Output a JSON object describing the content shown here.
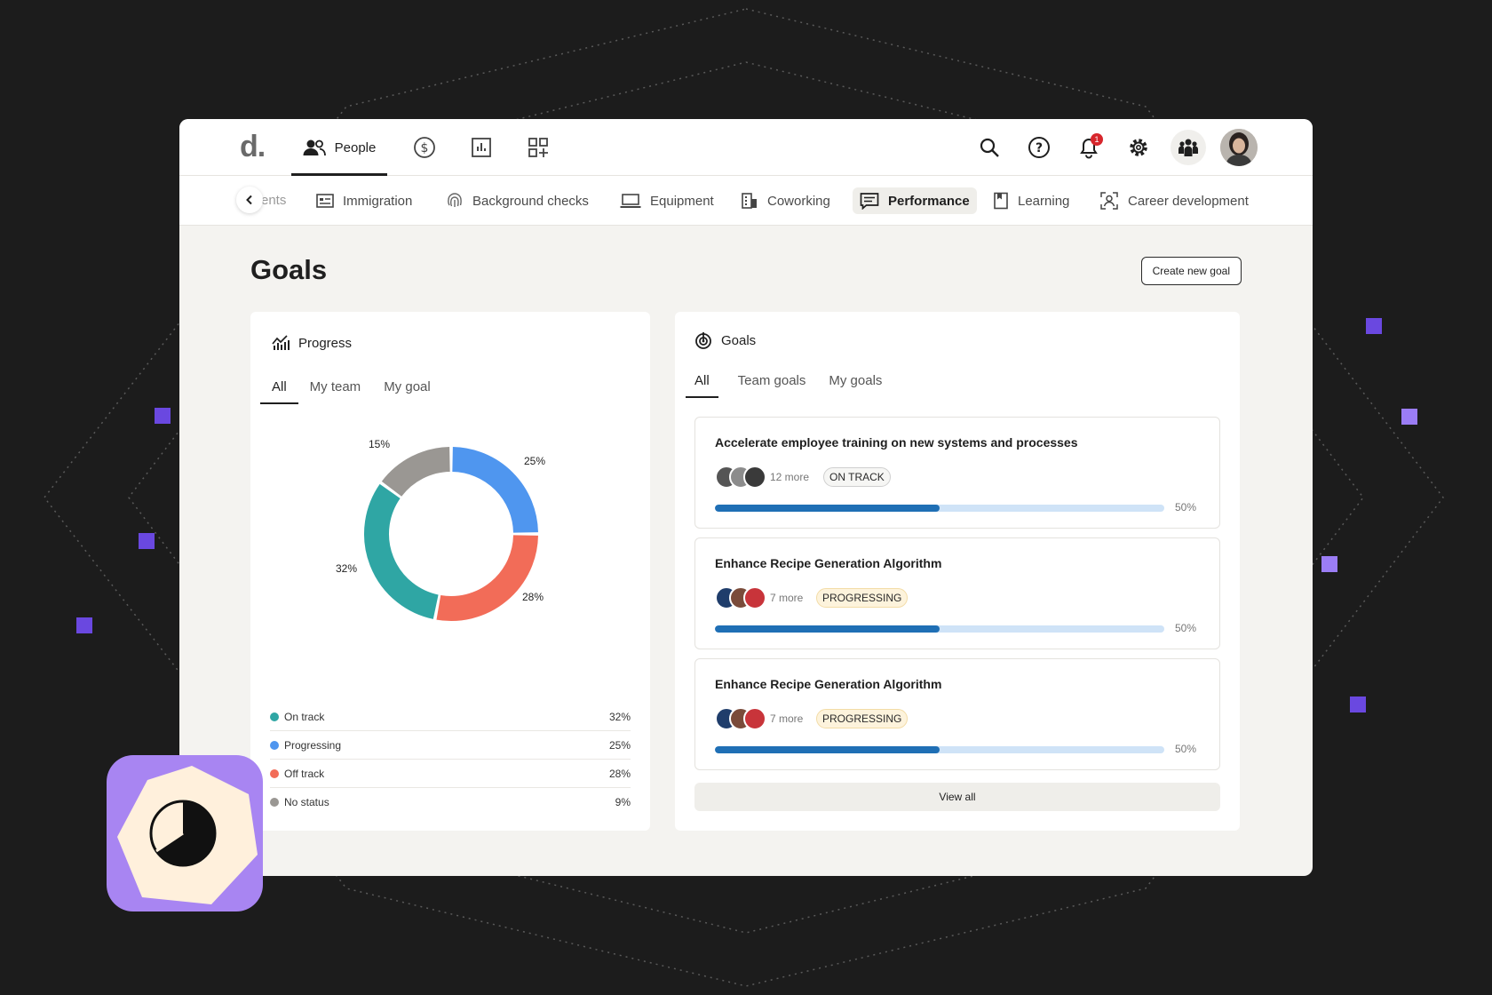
{
  "colors": {
    "accent": "#1f6fb5",
    "on_track": "#2fa6a4",
    "progressing": "#4f96ef",
    "off_track": "#f26c58",
    "no_status": "#9a9793",
    "badge_bg": "#a885f2",
    "deco_square": "#7d5cf0"
  },
  "topnav": {
    "logo": "d.",
    "people_label": "People",
    "notification_count": "1"
  },
  "subnav": {
    "faded_item": "ents",
    "items": [
      {
        "label": "Immigration",
        "icon": "id-card-icon"
      },
      {
        "label": "Background checks",
        "icon": "fingerprint-icon"
      },
      {
        "label": "Equipment",
        "icon": "laptop-icon"
      },
      {
        "label": "Coworking",
        "icon": "building-icon"
      },
      {
        "label": "Performance",
        "icon": "message-square-icon"
      },
      {
        "label": "Learning",
        "icon": "bookmark-icon"
      },
      {
        "label": "Career development",
        "icon": "user-focus-icon"
      }
    ]
  },
  "page": {
    "title": "Goals",
    "create_button": "Create new goal"
  },
  "progress_card": {
    "title": "Progress",
    "tabs": [
      "All",
      "My team",
      "My goal"
    ],
    "legend": [
      {
        "label": "On track",
        "value": "32%"
      },
      {
        "label": "Progressing",
        "value": "25%"
      },
      {
        "label": "Off track",
        "value": "28%"
      },
      {
        "label": "No status",
        "value": "9%"
      }
    ]
  },
  "chart_data": {
    "type": "pie",
    "categories": [
      "Progressing",
      "Off track",
      "On track",
      "No status"
    ],
    "values": [
      25,
      28,
      32,
      15
    ],
    "labels": [
      "25%",
      "28%",
      "32%",
      "15%"
    ]
  },
  "goals_card": {
    "title": "Goals",
    "tabs": [
      "All",
      "Team goals",
      "My goals"
    ],
    "items": [
      {
        "title": "Accelerate employee training on new systems and processes",
        "more": "12 more",
        "status": "ON TRACK",
        "progress": 50,
        "progress_label": "50%"
      },
      {
        "title": "Enhance Recipe Generation Algorithm",
        "more": "7 more",
        "status": "PROGRESSING",
        "progress": 50,
        "progress_label": "50%"
      },
      {
        "title": "Enhance Recipe Generation Algorithm",
        "more": "7 more",
        "status": "PROGRESSING",
        "progress": 50,
        "progress_label": "50%"
      }
    ],
    "view_all": "View all"
  }
}
